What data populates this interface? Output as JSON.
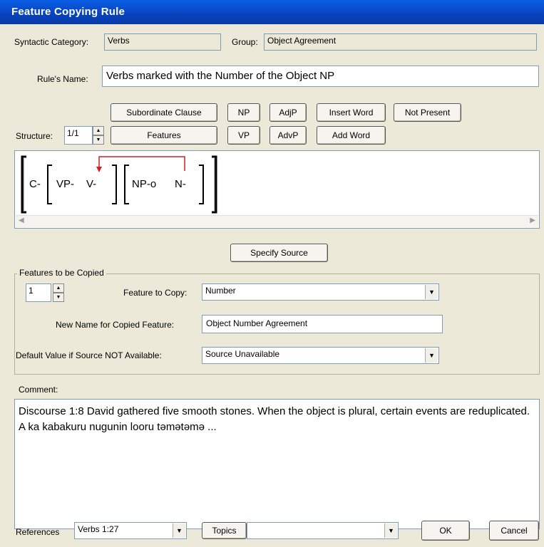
{
  "window": {
    "title": "Feature Copying Rule"
  },
  "header": {
    "syntactic_category_label": "Syntactic Category:",
    "syntactic_category_value": "Verbs",
    "group_label": "Group:",
    "group_value": "Object Agreement",
    "rule_name_label": "Rule's Name:",
    "rule_name_value": "Verbs marked with the Number of the Object NP"
  },
  "toolbar": {
    "subordinate_clause": "Subordinate Clause",
    "features": "Features",
    "np": "NP",
    "vp": "VP",
    "adjp": "AdjP",
    "advp": "AdvP",
    "insert_word": "Insert Word",
    "add_word": "Add Word",
    "not_present": "Not Present",
    "structure_label": "Structure:",
    "structure_value": "1/1"
  },
  "structure": {
    "clause": "C-",
    "vp": "VP-",
    "v": "V-",
    "np": "NP-o",
    "n": "N-"
  },
  "specify_source": "Specify Source",
  "features_group": {
    "title": "Features to be Copied",
    "index_value": "1",
    "feature_to_copy_label": "Feature to Copy:",
    "feature_to_copy_value": "Number",
    "new_name_label": "New Name for Copied Feature:",
    "new_name_value": "Object Number Agreement",
    "default_label": "Default Value if Source NOT Available:",
    "default_value": "Source Unavailable"
  },
  "comment": {
    "label": "Comment:",
    "text": "Discourse 1:8  David gathered five smooth stones.  When the object is plural, certain events are reduplicated.  A ka kabakuru nugunin looru təmətəmə ..."
  },
  "footer": {
    "references_label": "References",
    "references_value": "Verbs 1:27",
    "topics": "Topics",
    "topics_value": "",
    "ok": "OK",
    "cancel": "Cancel"
  },
  "colors": {
    "titlebar": "#0842bd",
    "arrow": "#cc2222",
    "dialog": "#ece9d8"
  },
  "icons": {
    "spin_up": "triangle-up",
    "spin_down": "triangle-down",
    "dropdown": "chevron-down"
  }
}
